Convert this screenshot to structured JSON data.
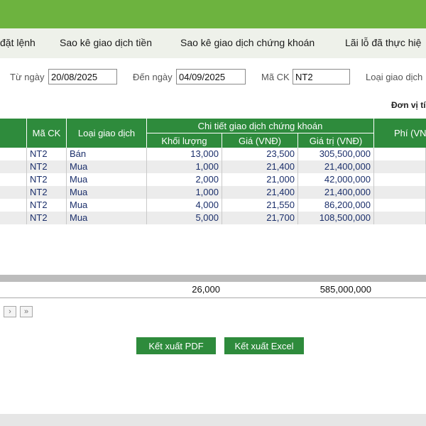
{
  "tabs": [
    "đặt lệnh",
    "Sao kê giao dịch tiền",
    "Sao kê giao dịch chứng khoán",
    "Lãi lỗ đã thực hiệ"
  ],
  "filters": {
    "from_label": "Từ ngày",
    "from_value": "20/08/2025",
    "to_label": "Đến ngày",
    "to_value": "04/09/2025",
    "code_label": "Mã CK",
    "code_value": "NT2",
    "type_label": "Loại giao dịch"
  },
  "unit_note": "Đơn vị tí",
  "table": {
    "header_code": "Mã CK",
    "header_type": "Loại giao dịch",
    "header_group": "Chi tiết giao dịch chứng khoán",
    "header_qty": "Khối lượng",
    "header_price": "Giá (VNĐ)",
    "header_value": "Giá trị (VNĐ)",
    "header_fee": "Phí (VN",
    "rows": [
      {
        "code": "NT2",
        "type": "Bán",
        "qty": "13,000",
        "price": "23,500",
        "value": "305,500,000"
      },
      {
        "code": "NT2",
        "type": "Mua",
        "qty": "1,000",
        "price": "21,400",
        "value": "21,400,000"
      },
      {
        "code": "NT2",
        "type": "Mua",
        "qty": "2,000",
        "price": "21,000",
        "value": "42,000,000"
      },
      {
        "code": "NT2",
        "type": "Mua",
        "qty": "1,000",
        "price": "21,400",
        "value": "21,400,000"
      },
      {
        "code": "NT2",
        "type": "Mua",
        "qty": "4,000",
        "price": "21,550",
        "value": "86,200,000"
      },
      {
        "code": "NT2",
        "type": "Mua",
        "qty": "5,000",
        "price": "21,700",
        "value": "108,500,000"
      }
    ]
  },
  "totals": {
    "qty": "26,000",
    "value": "585,000,000"
  },
  "pager": {
    "next": "›",
    "last": "»"
  },
  "buttons": {
    "pdf": "Kết xuất PDF",
    "excel": "Kết xuất Excel"
  },
  "colors": {
    "brand_green": "#6db33f",
    "header_green": "#2e8b3c",
    "cell_text": "#1b2f6b"
  }
}
